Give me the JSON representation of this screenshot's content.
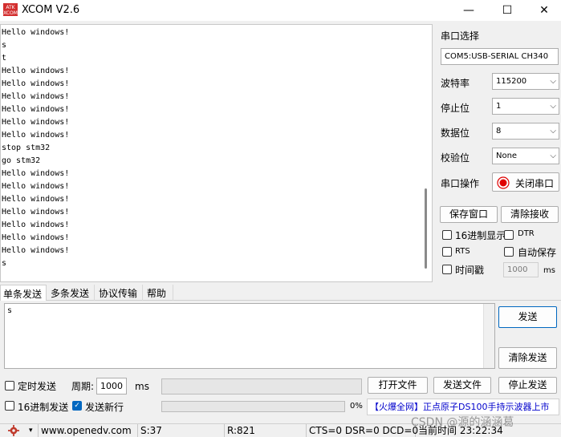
{
  "window": {
    "title": "XCOM V2.6",
    "minimize": "—",
    "maximize": "☐",
    "close": "✕"
  },
  "receive": {
    "lines": [
      "Hello windows!",
      "s",
      "t",
      "Hello windows!",
      "Hello windows!",
      "Hello windows!",
      "Hello windows!",
      "Hello windows!",
      "Hello windows!",
      "stop stm32",
      "go stm32",
      "Hello windows!",
      "Hello windows!",
      "Hello windows!",
      "Hello windows!",
      "Hello windows!",
      "Hello windows!",
      "Hello windows!",
      "s"
    ]
  },
  "panel": {
    "port_label": "串口选择",
    "port_value": "COM5:USB-SERIAL CH340",
    "baud_label": "波特率",
    "baud_value": "115200",
    "stopbits_label": "停止位",
    "stopbits_value": "1",
    "databits_label": "数据位",
    "databits_value": "8",
    "parity_label": "校验位",
    "parity_value": "None",
    "op_label": "串口操作",
    "close_port": "关闭串口",
    "save_window": "保存窗口",
    "clear_recv": "清除接收",
    "hex_display": "16进制显示",
    "dtr": "DTR",
    "rts": "RTS",
    "auto_save": "自动保存",
    "timestamp": "时间戳",
    "timestamp_value": "1000",
    "ms": "ms",
    "arrow": "⌵"
  },
  "tabs": [
    {
      "label": "单条发送"
    },
    {
      "label": "多条发送"
    },
    {
      "label": "协议传输"
    },
    {
      "label": "帮助"
    }
  ],
  "send": {
    "text": "s",
    "send_btn": "发送",
    "clear_send": "清除发送",
    "timed_send": "定时发送",
    "period_label": "周期:",
    "period_value": "1000",
    "ms": "ms",
    "open_file": "打开文件",
    "send_file": "发送文件",
    "stop_send": "停止发送",
    "hex_send": "16进制发送",
    "send_newline": "发送新行",
    "percent": "0%",
    "progress": 0,
    "ad_left": "【火爆全网】",
    "ad_right": "正点原子DS100手持示波器上市"
  },
  "status": {
    "site": "www.openedv.com",
    "s": "S:37",
    "r": "R:821",
    "signals": "CTS=0 DSR=0 DCD=0",
    "time": "当前时间 23:22:34"
  },
  "watermark": "CSDN @源的涵涵葛",
  "colors": {
    "accent": "#0067c0",
    "record_red": "#e00000",
    "ad_blue": "#0000cc"
  }
}
